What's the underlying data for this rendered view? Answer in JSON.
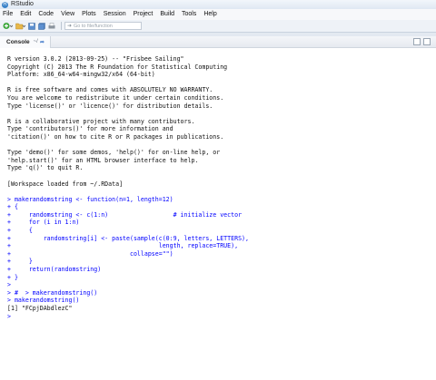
{
  "window": {
    "title": "RStudio"
  },
  "menu": [
    "File",
    "Edit",
    "Code",
    "View",
    "Plots",
    "Session",
    "Project",
    "Build",
    "Tools",
    "Help"
  ],
  "toolbar": {
    "goto_placeholder": "Go to file/function"
  },
  "pane": {
    "tab_label": "Console",
    "tab_dir": "~/"
  },
  "console": {
    "lines": [
      {
        "t": "output",
        "text": "R version 3.0.2 (2013-09-25) -- \"Frisbee Sailing\""
      },
      {
        "t": "output",
        "text": "Copyright (C) 2013 The R Foundation for Statistical Computing"
      },
      {
        "t": "output",
        "text": "Platform: x86_64-w64-mingw32/x64 (64-bit)"
      },
      {
        "t": "output",
        "text": ""
      },
      {
        "t": "output",
        "text": "R is free software and comes with ABSOLUTELY NO WARRANTY."
      },
      {
        "t": "output",
        "text": "You are welcome to redistribute it under certain conditions."
      },
      {
        "t": "output",
        "text": "Type 'license()' or 'licence()' for distribution details."
      },
      {
        "t": "output",
        "text": ""
      },
      {
        "t": "output",
        "text": "R is a collaborative project with many contributors."
      },
      {
        "t": "output",
        "text": "Type 'contributors()' for more information and"
      },
      {
        "t": "output",
        "text": "'citation()' on how to cite R or R packages in publications."
      },
      {
        "t": "output",
        "text": ""
      },
      {
        "t": "output",
        "text": "Type 'demo()' for some demos, 'help()' for on-line help, or"
      },
      {
        "t": "output",
        "text": "'help.start()' for an HTML browser interface to help."
      },
      {
        "t": "output",
        "text": "Type 'q()' to quit R."
      },
      {
        "t": "output",
        "text": ""
      },
      {
        "t": "output",
        "text": "[Workspace loaded from ~/.RData]"
      },
      {
        "t": "output",
        "text": ""
      },
      {
        "t": "input",
        "text": "> makerandomstring <- function(n=1, length=12)"
      },
      {
        "t": "input",
        "text": "+ {"
      },
      {
        "t": "input",
        "text": "+     randomstring <- c(1:n)                  # initialize vector"
      },
      {
        "t": "input",
        "text": "+     for (i in 1:n)"
      },
      {
        "t": "input",
        "text": "+     {"
      },
      {
        "t": "input",
        "text": "+         randomstring[i] <- paste(sample(c(0:9, letters, LETTERS),"
      },
      {
        "t": "input",
        "text": "+                                         length, replace=TRUE),"
      },
      {
        "t": "input",
        "text": "+                                 collapse=\"\")"
      },
      {
        "t": "input",
        "text": "+     }"
      },
      {
        "t": "input",
        "text": "+     return(randomstring)"
      },
      {
        "t": "input",
        "text": "+ }"
      },
      {
        "t": "input",
        "text": ">"
      },
      {
        "t": "input",
        "text": "> #  > makerandomstring()"
      },
      {
        "t": "input",
        "text": "> makerandomstring()"
      },
      {
        "t": "output",
        "text": "[1] \"FCpjDAbdlezC\""
      },
      {
        "t": "input",
        "text": ">"
      }
    ]
  }
}
